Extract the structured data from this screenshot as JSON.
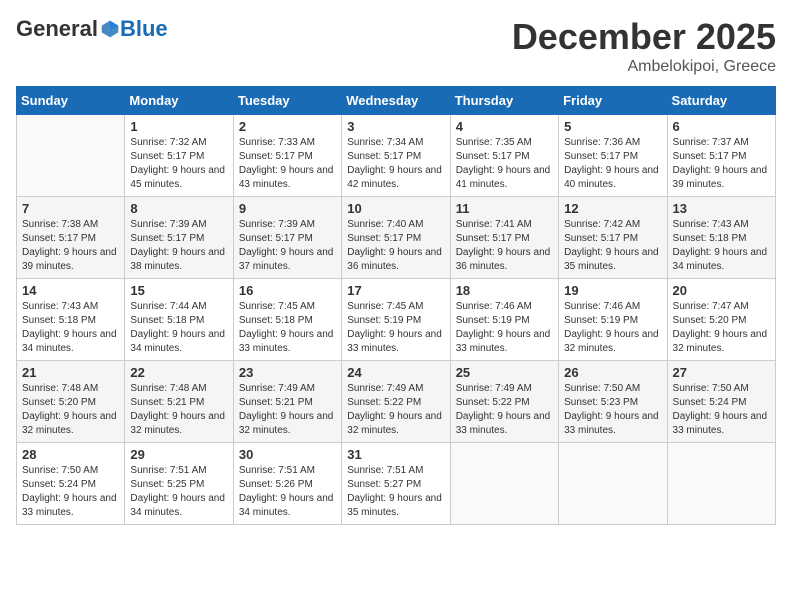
{
  "header": {
    "logo_general": "General",
    "logo_blue": "Blue",
    "month_title": "December 2025",
    "location": "Ambelokipoi, Greece"
  },
  "days_of_week": [
    "Sunday",
    "Monday",
    "Tuesday",
    "Wednesday",
    "Thursday",
    "Friday",
    "Saturday"
  ],
  "weeks": [
    [
      {
        "day": "",
        "sunrise": "",
        "sunset": "",
        "daylight": ""
      },
      {
        "day": "1",
        "sunrise": "Sunrise: 7:32 AM",
        "sunset": "Sunset: 5:17 PM",
        "daylight": "Daylight: 9 hours and 45 minutes."
      },
      {
        "day": "2",
        "sunrise": "Sunrise: 7:33 AM",
        "sunset": "Sunset: 5:17 PM",
        "daylight": "Daylight: 9 hours and 43 minutes."
      },
      {
        "day": "3",
        "sunrise": "Sunrise: 7:34 AM",
        "sunset": "Sunset: 5:17 PM",
        "daylight": "Daylight: 9 hours and 42 minutes."
      },
      {
        "day": "4",
        "sunrise": "Sunrise: 7:35 AM",
        "sunset": "Sunset: 5:17 PM",
        "daylight": "Daylight: 9 hours and 41 minutes."
      },
      {
        "day": "5",
        "sunrise": "Sunrise: 7:36 AM",
        "sunset": "Sunset: 5:17 PM",
        "daylight": "Daylight: 9 hours and 40 minutes."
      },
      {
        "day": "6",
        "sunrise": "Sunrise: 7:37 AM",
        "sunset": "Sunset: 5:17 PM",
        "daylight": "Daylight: 9 hours and 39 minutes."
      }
    ],
    [
      {
        "day": "7",
        "sunrise": "Sunrise: 7:38 AM",
        "sunset": "Sunset: 5:17 PM",
        "daylight": "Daylight: 9 hours and 39 minutes."
      },
      {
        "day": "8",
        "sunrise": "Sunrise: 7:39 AM",
        "sunset": "Sunset: 5:17 PM",
        "daylight": "Daylight: 9 hours and 38 minutes."
      },
      {
        "day": "9",
        "sunrise": "Sunrise: 7:39 AM",
        "sunset": "Sunset: 5:17 PM",
        "daylight": "Daylight: 9 hours and 37 minutes."
      },
      {
        "day": "10",
        "sunrise": "Sunrise: 7:40 AM",
        "sunset": "Sunset: 5:17 PM",
        "daylight": "Daylight: 9 hours and 36 minutes."
      },
      {
        "day": "11",
        "sunrise": "Sunrise: 7:41 AM",
        "sunset": "Sunset: 5:17 PM",
        "daylight": "Daylight: 9 hours and 36 minutes."
      },
      {
        "day": "12",
        "sunrise": "Sunrise: 7:42 AM",
        "sunset": "Sunset: 5:17 PM",
        "daylight": "Daylight: 9 hours and 35 minutes."
      },
      {
        "day": "13",
        "sunrise": "Sunrise: 7:43 AM",
        "sunset": "Sunset: 5:18 PM",
        "daylight": "Daylight: 9 hours and 34 minutes."
      }
    ],
    [
      {
        "day": "14",
        "sunrise": "Sunrise: 7:43 AM",
        "sunset": "Sunset: 5:18 PM",
        "daylight": "Daylight: 9 hours and 34 minutes."
      },
      {
        "day": "15",
        "sunrise": "Sunrise: 7:44 AM",
        "sunset": "Sunset: 5:18 PM",
        "daylight": "Daylight: 9 hours and 34 minutes."
      },
      {
        "day": "16",
        "sunrise": "Sunrise: 7:45 AM",
        "sunset": "Sunset: 5:18 PM",
        "daylight": "Daylight: 9 hours and 33 minutes."
      },
      {
        "day": "17",
        "sunrise": "Sunrise: 7:45 AM",
        "sunset": "Sunset: 5:19 PM",
        "daylight": "Daylight: 9 hours and 33 minutes."
      },
      {
        "day": "18",
        "sunrise": "Sunrise: 7:46 AM",
        "sunset": "Sunset: 5:19 PM",
        "daylight": "Daylight: 9 hours and 33 minutes."
      },
      {
        "day": "19",
        "sunrise": "Sunrise: 7:46 AM",
        "sunset": "Sunset: 5:19 PM",
        "daylight": "Daylight: 9 hours and 32 minutes."
      },
      {
        "day": "20",
        "sunrise": "Sunrise: 7:47 AM",
        "sunset": "Sunset: 5:20 PM",
        "daylight": "Daylight: 9 hours and 32 minutes."
      }
    ],
    [
      {
        "day": "21",
        "sunrise": "Sunrise: 7:48 AM",
        "sunset": "Sunset: 5:20 PM",
        "daylight": "Daylight: 9 hours and 32 minutes."
      },
      {
        "day": "22",
        "sunrise": "Sunrise: 7:48 AM",
        "sunset": "Sunset: 5:21 PM",
        "daylight": "Daylight: 9 hours and 32 minutes."
      },
      {
        "day": "23",
        "sunrise": "Sunrise: 7:49 AM",
        "sunset": "Sunset: 5:21 PM",
        "daylight": "Daylight: 9 hours and 32 minutes."
      },
      {
        "day": "24",
        "sunrise": "Sunrise: 7:49 AM",
        "sunset": "Sunset: 5:22 PM",
        "daylight": "Daylight: 9 hours and 32 minutes."
      },
      {
        "day": "25",
        "sunrise": "Sunrise: 7:49 AM",
        "sunset": "Sunset: 5:22 PM",
        "daylight": "Daylight: 9 hours and 33 minutes."
      },
      {
        "day": "26",
        "sunrise": "Sunrise: 7:50 AM",
        "sunset": "Sunset: 5:23 PM",
        "daylight": "Daylight: 9 hours and 33 minutes."
      },
      {
        "day": "27",
        "sunrise": "Sunrise: 7:50 AM",
        "sunset": "Sunset: 5:24 PM",
        "daylight": "Daylight: 9 hours and 33 minutes."
      }
    ],
    [
      {
        "day": "28",
        "sunrise": "Sunrise: 7:50 AM",
        "sunset": "Sunset: 5:24 PM",
        "daylight": "Daylight: 9 hours and 33 minutes."
      },
      {
        "day": "29",
        "sunrise": "Sunrise: 7:51 AM",
        "sunset": "Sunset: 5:25 PM",
        "daylight": "Daylight: 9 hours and 34 minutes."
      },
      {
        "day": "30",
        "sunrise": "Sunrise: 7:51 AM",
        "sunset": "Sunset: 5:26 PM",
        "daylight": "Daylight: 9 hours and 34 minutes."
      },
      {
        "day": "31",
        "sunrise": "Sunrise: 7:51 AM",
        "sunset": "Sunset: 5:27 PM",
        "daylight": "Daylight: 9 hours and 35 minutes."
      },
      {
        "day": "",
        "sunrise": "",
        "sunset": "",
        "daylight": ""
      },
      {
        "day": "",
        "sunrise": "",
        "sunset": "",
        "daylight": ""
      },
      {
        "day": "",
        "sunrise": "",
        "sunset": "",
        "daylight": ""
      }
    ]
  ]
}
